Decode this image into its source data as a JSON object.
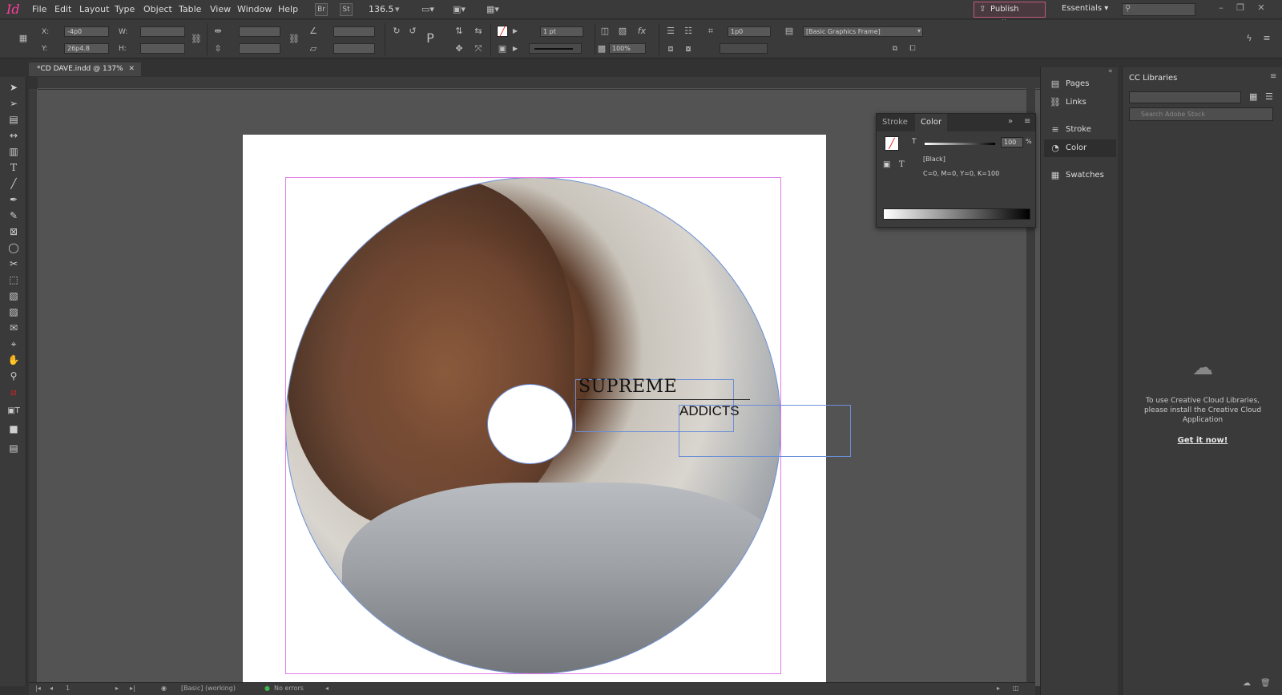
{
  "app": {
    "logo": "Id"
  },
  "menubar": {
    "items": [
      "File",
      "Edit",
      "Layout",
      "Type",
      "Object",
      "Table",
      "View",
      "Window",
      "Help"
    ],
    "bridge_label": "Br",
    "stock_label": "St",
    "zoom": "136.5",
    "publish_label": "Publish Online",
    "workspace": "Essentials"
  },
  "control": {
    "x_label": "X:",
    "x_value": "-4p0",
    "y_label": "Y:",
    "y_value": "26p4.8",
    "w_label": "W:",
    "w_value": "",
    "h_label": "H:",
    "h_value": "",
    "stroke_weight": "1 pt",
    "scale_percent": "100%",
    "offset_value": "1p0",
    "object_style": "[Basic Graphics Frame]"
  },
  "document": {
    "tab_title": "*CD DAVE.indd @ 137%",
    "title_text": "SUPREME",
    "subtitle_text": "ADDICTS"
  },
  "status": {
    "page": "1",
    "preflight_profile": "[Basic] (working)",
    "errors": "No errors"
  },
  "color_panel": {
    "tabs": [
      "Stroke",
      "Color"
    ],
    "active_tab": "Color",
    "tint_label": "T",
    "tint_value": "100",
    "percent_symbol": "%",
    "swatch_name": "[Black]",
    "cmyk": "C=0, M=0, Y=0, K=100"
  },
  "dock": {
    "items": [
      "Pages",
      "Links",
      "Stroke",
      "Color",
      "Swatches"
    ]
  },
  "cc_libraries": {
    "title": "CC Libraries",
    "search_placeholder": "Search Adobe Stock",
    "message": "To use Creative Cloud Libraries, please install the Creative Cloud Application",
    "link": "Get it now!"
  },
  "colors": {
    "accent": "#ff3d9a",
    "frame_selection": "#e17be9",
    "path_selection": "#6b8fd6"
  }
}
